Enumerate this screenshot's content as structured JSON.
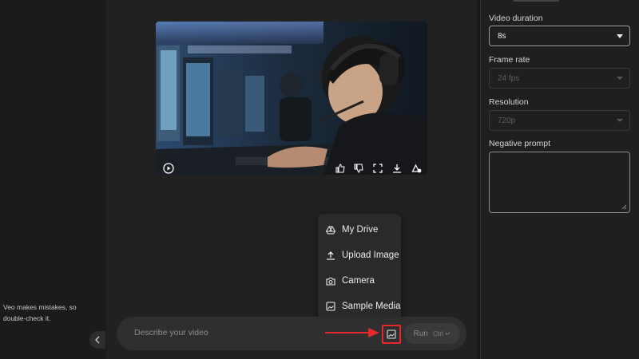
{
  "left_panel": {
    "disclaimer": "Veo makes mistakes, so double-check it.",
    "collapse_icon": "chevron-left-icon"
  },
  "video_controls": {
    "play": "play-icon",
    "like": "thumbs-up-icon",
    "dislike": "thumbs-down-icon",
    "fullscreen": "fullscreen-icon",
    "download": "download-icon",
    "extend": "extend-icon"
  },
  "media_menu": {
    "items": [
      {
        "label": "My Drive",
        "icon": "drive-icon"
      },
      {
        "label": "Upload Image",
        "icon": "upload-icon"
      },
      {
        "label": "Camera",
        "icon": "camera-icon"
      },
      {
        "label": "Sample Media",
        "icon": "image-icon"
      }
    ]
  },
  "prompt": {
    "placeholder": "Describe your video",
    "run_label": "Run",
    "run_shortcut": "Ctrl ↵"
  },
  "settings": {
    "video_duration": {
      "label": "Video duration",
      "value": "8s"
    },
    "frame_rate": {
      "label": "Frame rate",
      "value": "24 fps"
    },
    "resolution": {
      "label": "Resolution",
      "value": "720p"
    },
    "negative_prompt": {
      "label": "Negative prompt",
      "value": ""
    }
  },
  "colors": {
    "highlight": "#e8262c",
    "background": "#212121"
  }
}
